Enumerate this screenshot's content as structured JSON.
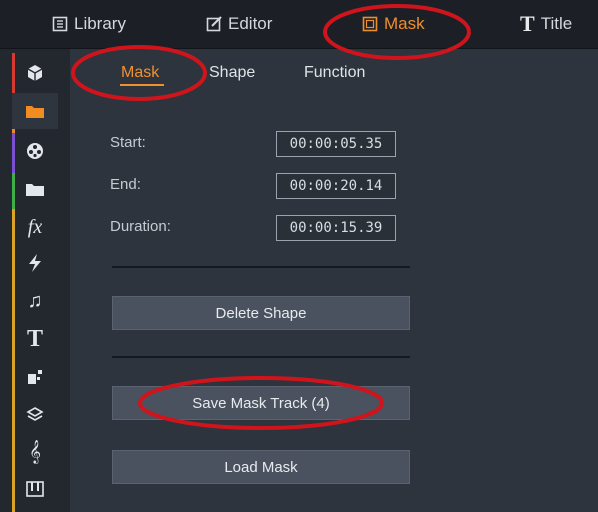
{
  "topbar": {
    "tabs": [
      {
        "label": "Library",
        "icon": "library-icon"
      },
      {
        "label": "Editor",
        "icon": "editor-icon"
      },
      {
        "label": "Mask",
        "icon": "mask-icon"
      },
      {
        "label": "Title",
        "icon": "title-icon"
      }
    ],
    "active_color": "#ef8d2e"
  },
  "sidebar": {
    "items": [
      {
        "icon": "box-icon"
      },
      {
        "icon": "folder-icon"
      },
      {
        "icon": "film-reel-icon"
      },
      {
        "icon": "folder-icon"
      },
      {
        "icon": "effects-icon",
        "glyph": "fx"
      },
      {
        "icon": "lightning-icon"
      },
      {
        "icon": "music-note-icon",
        "glyph": "♫"
      },
      {
        "icon": "text-icon",
        "glyph": "T"
      },
      {
        "icon": "shapes-icon"
      },
      {
        "icon": "layers-icon"
      },
      {
        "icon": "clef-icon",
        "glyph": "𝄞"
      },
      {
        "icon": "keyboard-icon"
      }
    ]
  },
  "panel": {
    "subtabs": [
      "Mask",
      "Shape",
      "Function"
    ],
    "fields": {
      "start_label": "Start:",
      "start_value": "00:00:05.35",
      "end_label": "End:",
      "end_value": "00:00:20.14",
      "duration_label": "Duration:",
      "duration_value": "00:00:15.39"
    },
    "buttons": {
      "delete_shape": "Delete Shape",
      "save_mask_track": "Save Mask Track (4)",
      "load_mask": "Load Mask"
    }
  },
  "annotation_color": "#d0141c"
}
